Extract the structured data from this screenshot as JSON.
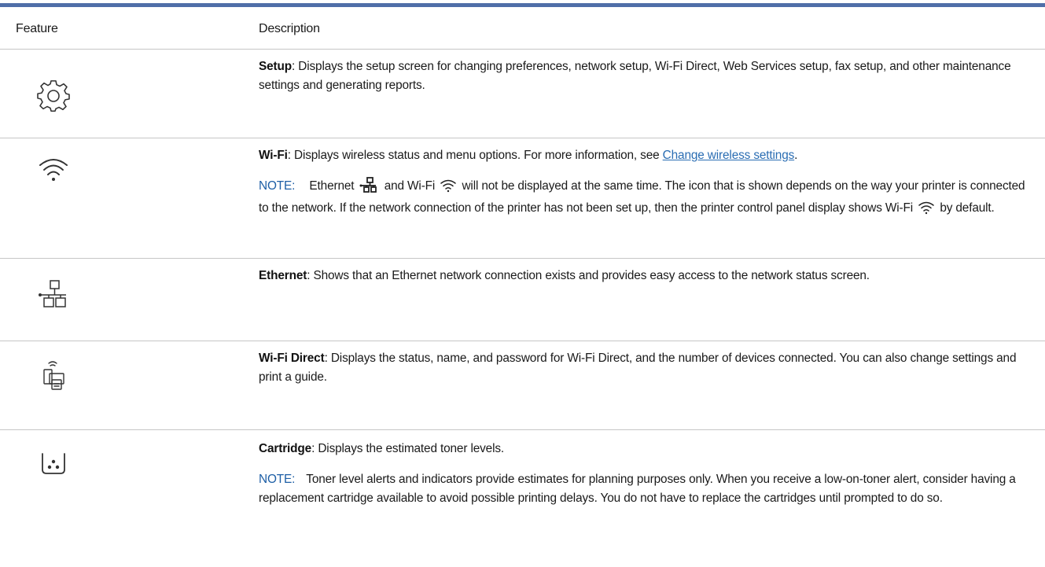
{
  "table": {
    "header": {
      "feature": "Feature",
      "description": "Description"
    },
    "rows": {
      "setup": {
        "icon": "gear-icon",
        "term": "Setup",
        "text": ": Displays the setup screen for changing preferences, network setup, Wi-Fi Direct, Web Services setup, fax setup, and other maintenance settings and generating reports."
      },
      "wifi": {
        "icon": "wifi-icon",
        "term": "Wi-Fi",
        "text": ": Displays wireless status and menu options. For more information, see ",
        "link": "Change wireless settings",
        "after_link": ".",
        "note_label": "NOTE:",
        "note_part1": "Ethernet",
        "note_part2": "and Wi-Fi",
        "note_part3": "will not be displayed at the same time. The icon that is shown depends on the way your printer is connected to the network. If the network connection of the printer has not been set up, then the printer control panel display shows Wi-Fi",
        "note_part4": "by default."
      },
      "ethernet": {
        "icon": "ethernet-icon",
        "term": "Ethernet",
        "text": ": Shows that an Ethernet network connection exists and provides easy access to the network status screen."
      },
      "wifidirect": {
        "icon": "wifi-direct-icon",
        "term": "Wi-Fi Direct",
        "text": ": Displays the status, name, and password for Wi-Fi Direct, and the number of devices connected. You can also change settings and print a guide."
      },
      "cartridge": {
        "icon": "cartridge-icon",
        "term": "Cartridge",
        "text": ": Displays the estimated toner levels.",
        "note_label": "NOTE:",
        "note": "Toner level alerts and indicators provide estimates for planning purposes only. When you receive a low-on-toner alert, consider having a replacement cartridge available to avoid possible printing delays. You do not have to replace the cartridges until prompted to do so."
      }
    }
  },
  "colors": {
    "top_rule": "#4f6ea8",
    "note_label": "#1e5fa6",
    "link": "#2a6db3",
    "row_border": "#c6c6c6"
  }
}
